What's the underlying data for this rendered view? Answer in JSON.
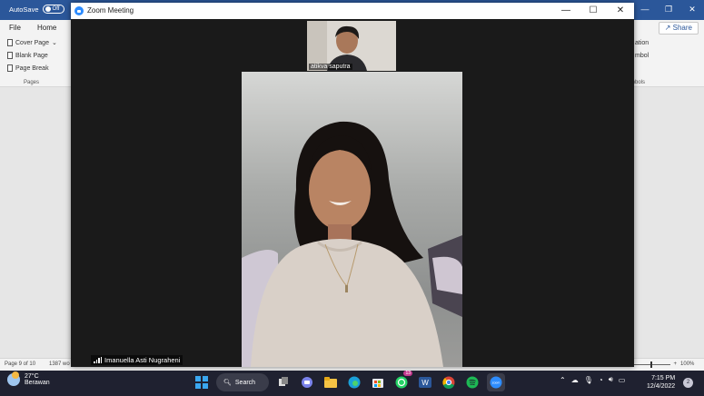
{
  "word": {
    "autosave_label": "AutoSave",
    "autosave_state": "Off",
    "tabs": [
      "File",
      "Home"
    ],
    "share_label": "Share",
    "ribbon_items": [
      "Cover Page",
      "Blank Page",
      "Page Break"
    ],
    "ribbon_group": "Pages",
    "ribbon_right_items": [
      "ation",
      "mbol"
    ],
    "ribbon_right_group": "mbols",
    "status_page": "Page 9 of 10",
    "status_words": "1387 wo",
    "zoom_level": "100%"
  },
  "zoom": {
    "title": "Zoom Meeting",
    "thumb_participant": "atikva saputra",
    "speaker_name": "Imanuella Asti Nugraheni"
  },
  "taskbar": {
    "weather_temp": "27°C",
    "weather_desc": "Berawan",
    "search_label": "Search",
    "whatsapp_badge": "13",
    "time": "7:15 PM",
    "date": "12/4/2022",
    "notifications": "2"
  }
}
